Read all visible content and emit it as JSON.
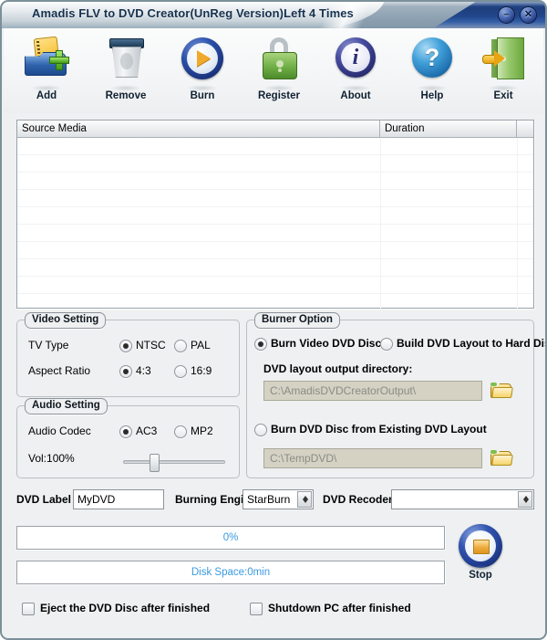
{
  "window": {
    "title": "Amadis FLV to DVD Creator(UnReg Version)Left 4 Times",
    "minimize_glyph": "–",
    "close_glyph": "✕"
  },
  "toolbar": {
    "items": [
      {
        "label": "Add",
        "icon": "add-folder-icon"
      },
      {
        "label": "Remove",
        "icon": "trash-icon"
      },
      {
        "label": "Burn",
        "icon": "burn-play-icon"
      },
      {
        "label": "Register",
        "icon": "padlock-icon"
      },
      {
        "label": "About",
        "icon": "info-icon"
      },
      {
        "label": "Help",
        "icon": "question-icon"
      },
      {
        "label": "Exit",
        "icon": "exit-door-icon"
      }
    ],
    "help_glyph": "?",
    "about_glyph": "i"
  },
  "media_list": {
    "columns": [
      "Source Media",
      "Duration",
      ""
    ],
    "rows": []
  },
  "video_setting": {
    "title": "Video Setting",
    "tv_type_label": "TV Type",
    "tv_type_options": [
      "NTSC",
      "PAL"
    ],
    "tv_type_selected": "NTSC",
    "aspect_label": "Aspect Ratio",
    "aspect_options": [
      "4:3",
      "16:9"
    ],
    "aspect_selected": "4:3"
  },
  "audio_setting": {
    "title": "Audio Setting",
    "codec_label": "Audio Codec",
    "codec_options": [
      "AC3",
      "MP2"
    ],
    "codec_selected": "AC3",
    "volume_label": "Vol:100%",
    "volume_percent": 100
  },
  "burner_option": {
    "title": "Burner Option",
    "mode_options": [
      "Burn Video DVD Disc",
      "Build DVD Layout to Hard Disk"
    ],
    "mode_selected": "Burn Video DVD Disc",
    "output_dir_label": "DVD layout output directory:",
    "output_dir_value": "C:\\AmadisDVDCreatorOutput\\",
    "existing_layout_label": "Burn DVD Disc from Existing DVD Layout",
    "existing_layout_selected": false,
    "existing_dir_value": "C:\\TempDVD\\",
    "browse_icon": "folder-open-icon"
  },
  "bottom_bar": {
    "dvd_label_caption": "DVD Label",
    "dvd_label_value": "MyDVD",
    "burning_engine_caption": "Burning Engine",
    "burning_engine_value": "StarBurn",
    "dvd_recorder_caption": "DVD Recoder",
    "dvd_recorder_value": ""
  },
  "status": {
    "progress_text": "0%",
    "progress_percent": 0,
    "disk_space_text": "Disk Space:0min",
    "text_color": "#3a9ae0",
    "stop_label": "Stop",
    "stop_icon": "stop-square-icon"
  },
  "finish_options": {
    "eject_label": "Eject the DVD Disc after finished",
    "eject_checked": false,
    "shutdown_label": "Shutdown PC after finished",
    "shutdown_checked": false
  }
}
